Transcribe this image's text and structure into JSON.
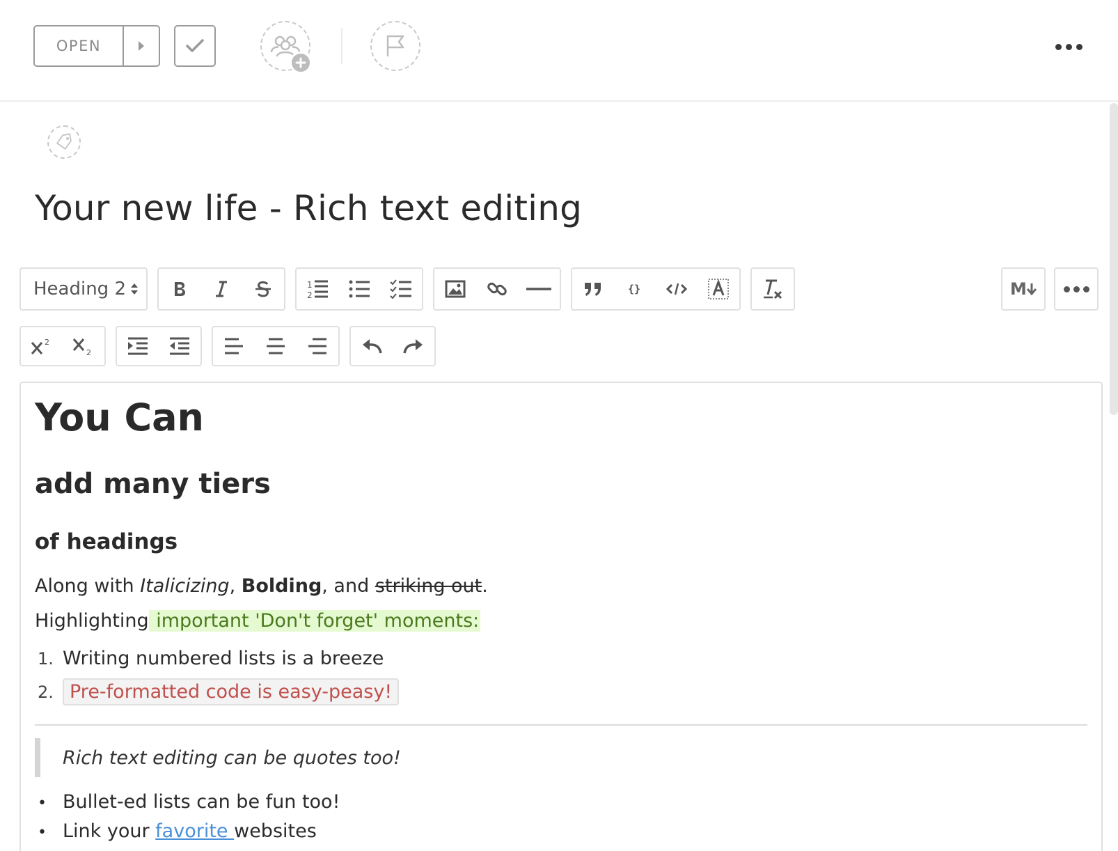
{
  "toolbar_top": {
    "status_label": "OPEN",
    "more_label": "More options"
  },
  "task": {
    "title": "Your new life - Rich text editing"
  },
  "editor_toolbar": {
    "block_format": "Heading 2",
    "row1_groups": [
      [
        "bold-icon",
        "italic-icon",
        "strikethrough-icon"
      ],
      [
        "ordered-list-icon",
        "bullet-list-icon",
        "checklist-icon"
      ],
      [
        "image-icon",
        "link-icon",
        "horizontal-rule-icon"
      ],
      [
        "quote-icon",
        "code-block-icon",
        "inline-code-icon",
        "highlight-icon"
      ],
      [
        "clear-format-icon"
      ]
    ],
    "markdown_label": "M",
    "row2_groups": [
      [
        "superscript-icon",
        "subscript-icon"
      ],
      [
        "indent-icon",
        "outdent-icon"
      ],
      [
        "align-left-icon",
        "align-center-icon",
        "align-right-icon"
      ],
      [
        "undo-icon",
        "redo-icon"
      ]
    ]
  },
  "content": {
    "h1": "You Can",
    "h2": "add many tiers",
    "h3": "of headings",
    "p1": {
      "prefix": "Along with ",
      "italic": "Italicizing",
      "sep1": ", ",
      "bold": "Bolding",
      "sep2": ", and ",
      "strike": "striking out",
      "suffix": "."
    },
    "p2": {
      "prefix": "Highlighting",
      "highlight": " important 'Don't forget' moments:"
    },
    "ordered_list": [
      {
        "num": "1.",
        "text": "Writing numbered lists is a breeze"
      },
      {
        "num": "2.",
        "text": "Pre-formatted code is easy-peasy!"
      }
    ],
    "quote": "Rich text editing can be quotes too!",
    "bullet_list": [
      {
        "text": "Bullet-ed lists can be fun too!"
      },
      {
        "prefix": "Link your ",
        "link": "favorite ",
        "suffix": "websites"
      }
    ]
  },
  "colors": {
    "highlight_bg": "#e6fad2",
    "highlight_text": "#4a7a1e",
    "code_text": "#c0504d",
    "link": "#4a90d9"
  }
}
